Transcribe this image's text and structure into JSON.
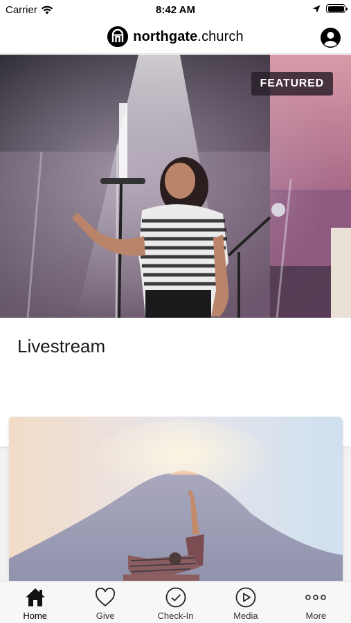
{
  "status_bar": {
    "carrier": "Carrier",
    "time": "8:42 AM"
  },
  "header": {
    "logo_bold": "northgate",
    "logo_regular": ".church"
  },
  "feed": {
    "featured_item": {
      "badge": "FEATURED",
      "title": "Livestream"
    }
  },
  "tab_bar": {
    "tabs": [
      {
        "label": "Home",
        "icon": "home-icon",
        "active": true
      },
      {
        "label": "Give",
        "icon": "heart-icon",
        "active": false
      },
      {
        "label": "Check-In",
        "icon": "check-circle-icon",
        "active": false
      },
      {
        "label": "Media",
        "icon": "play-circle-icon",
        "active": false
      },
      {
        "label": "More",
        "icon": "more-dots-icon",
        "active": false
      }
    ]
  },
  "colors": {
    "background": "#f2f2f4",
    "tab_bar": "#f7f7f8",
    "badge": "#281e28"
  }
}
